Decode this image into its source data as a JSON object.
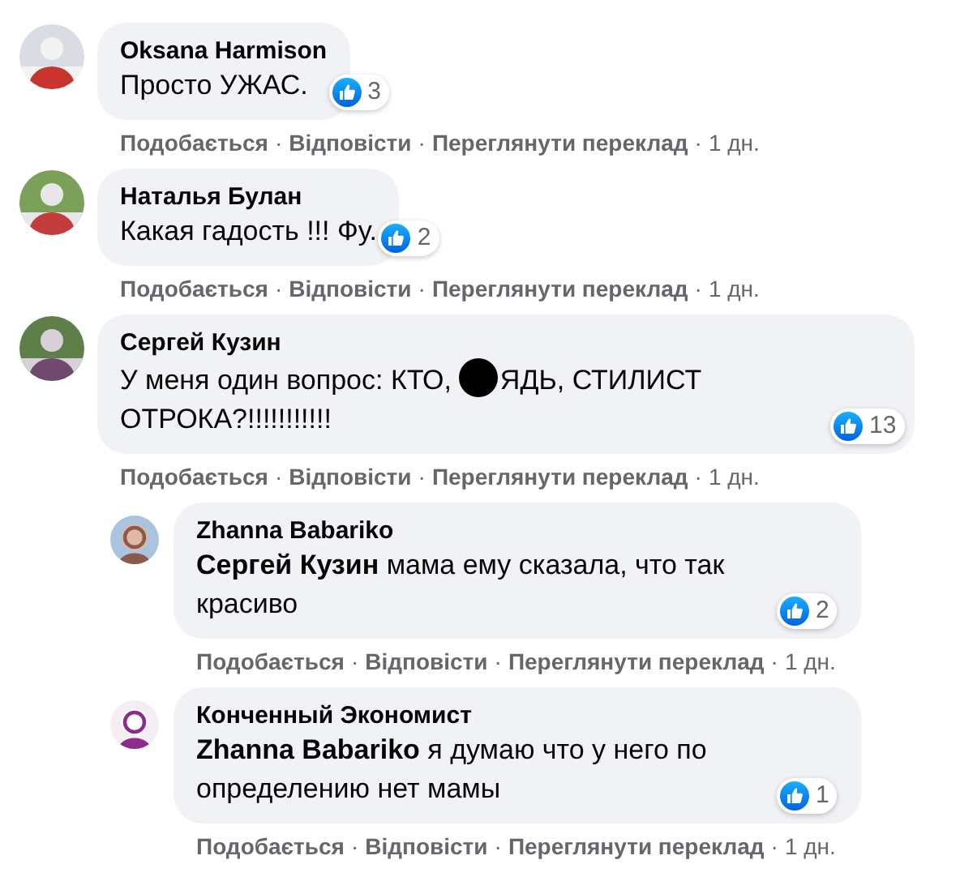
{
  "separator": "·",
  "comments": [
    {
      "author": "Oksana Harmison",
      "segments": [
        {
          "kind": "text",
          "text": "Просто УЖАС."
        }
      ],
      "reactions": "3",
      "actions": [
        "Подобається",
        "Відповісти",
        "Переглянути переклад"
      ],
      "time": "1 дн."
    },
    {
      "author": "Наталья Булан",
      "segments": [
        {
          "kind": "text",
          "text": "Какая гадость !!! Фу."
        }
      ],
      "reactions": "2",
      "actions": [
        "Подобається",
        "Відповісти",
        "Переглянути переклад"
      ],
      "time": "1 дн."
    },
    {
      "author": "Сергей Кузин",
      "segments": [
        {
          "kind": "phrase",
          "text": "У меня один вопрос: КТО,"
        },
        {
          "kind": "blot"
        },
        {
          "kind": "phrase",
          "text": "ЯДЬ, СТИЛИСТ"
        },
        {
          "kind": "phrase",
          "text": "ОТРОКА?!!!!!!!!!!!"
        }
      ],
      "reactions": "13",
      "actions": [
        "Подобається",
        "Відповісти",
        "Переглянути переклад"
      ],
      "time": "1 дн.",
      "replies": [
        {
          "author": "Zhanna Babariko",
          "segments": [
            {
              "kind": "text",
              "text": "**Сергей Кузин** мама ему сказала, что так красиво"
            }
          ],
          "reactions": "2",
          "actions": [
            "Подобається",
            "Відповісти",
            "Переглянути переклад"
          ],
          "time": "1 дн."
        },
        {
          "author": "Конченный Экономист",
          "segments": [
            {
              "kind": "text",
              "text": "**Zhanna Babariko** я думаю что у него по определению нет мамы"
            }
          ],
          "reactions": "1",
          "actions": [
            "Подобається",
            "Відповісти",
            "Переглянути переклад"
          ],
          "time": "1 дн."
        }
      ]
    }
  ]
}
